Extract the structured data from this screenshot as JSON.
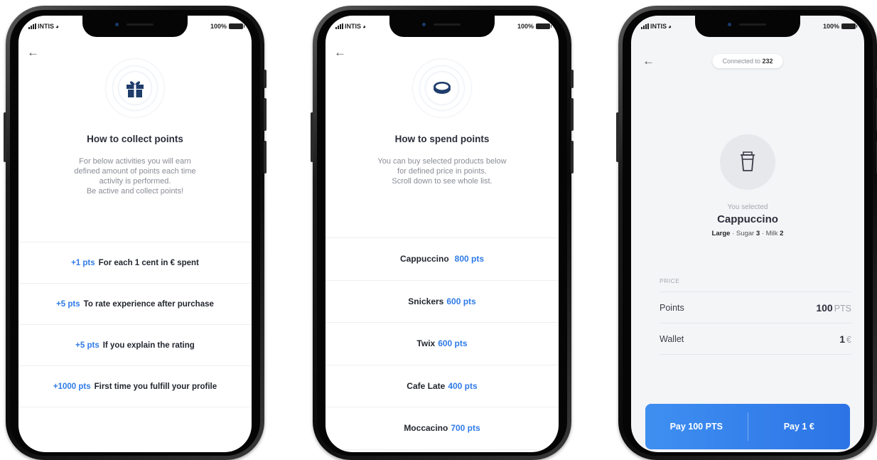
{
  "status": {
    "carrier": "INTIS",
    "battery": "100%"
  },
  "colors": {
    "accent": "#2f7be8",
    "pay_button": "#3a86ef",
    "icon_navy": "#1f3d6b"
  },
  "collect": {
    "back_icon": "back-arrow-icon",
    "hero_icon": "gift-icon",
    "title": "How to collect points",
    "desc_lines": [
      "For below activities you will earn",
      "defined amount of points each time",
      "activity is performed.",
      "Be active and collect points!"
    ],
    "items": [
      {
        "pts": "+1 pts",
        "text": "For each 1 cent in € spent"
      },
      {
        "pts": "+5 pts",
        "text": "To rate experience after purchase"
      },
      {
        "pts": "+5 pts",
        "text": "If you explain the rating"
      },
      {
        "pts": "+1000 pts",
        "text": "First time you fulfill your profile"
      }
    ]
  },
  "spend": {
    "back_icon": "back-arrow-icon",
    "hero_icon": "coin-icon",
    "title": "How to spend points",
    "desc_lines": [
      "You can buy selected products below",
      "for defined price in points.",
      "Scroll down to see whole list."
    ],
    "items": [
      {
        "name": "Cappuccino",
        "pts": "800 pts"
      },
      {
        "name": "Snickers",
        "pts": "600 pts"
      },
      {
        "name": "Twix",
        "pts": "600 pts"
      },
      {
        "name": "Cafe Late",
        "pts": "400 pts"
      },
      {
        "name": "Moccacino",
        "pts": "700 pts"
      }
    ]
  },
  "purchase": {
    "back_icon": "back-arrow-icon",
    "connected_label": "Connected to",
    "connected_value": "232",
    "product_icon": "cup-icon",
    "selected_label": "You selected",
    "product_name": "Cappuccino",
    "size": "Large",
    "sugar_label": "Sugar",
    "sugar_value": "3",
    "milk_label": "Milk",
    "milk_value": "2",
    "price_label": "PRICE",
    "points_label": "Points",
    "points_value": "100",
    "points_unit": "PTS",
    "wallet_label": "Wallet",
    "wallet_value": "1",
    "wallet_unit": "€",
    "pay_points_label": "Pay 100 PTS",
    "pay_wallet_label": "Pay 1 €"
  }
}
